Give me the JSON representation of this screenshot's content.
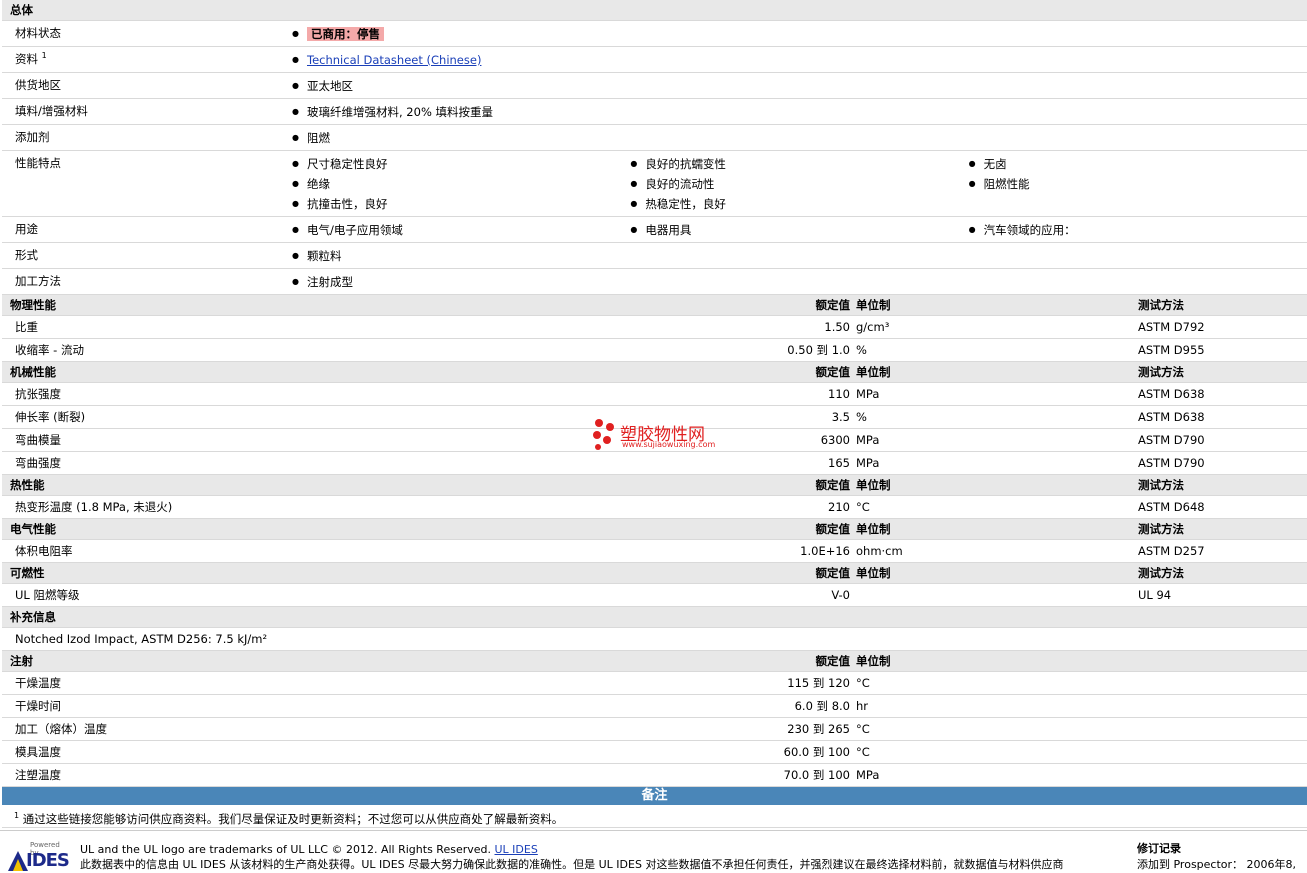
{
  "general": {
    "title": "总体",
    "rows": [
      {
        "label": "材料状态",
        "cols": [
          [
            "已商用：停售"
          ],
          [],
          []
        ],
        "highlight": true
      },
      {
        "label": "资料",
        "sup": "1",
        "cols": [
          [
            "Technical Datasheet (Chinese)"
          ],
          [],
          []
        ],
        "link": true
      },
      {
        "label": "供货地区",
        "cols": [
          [
            "亚太地区"
          ],
          [],
          []
        ]
      },
      {
        "label": "填料/增强材料",
        "cols": [
          [
            "玻璃纤维增强材料, 20% 填料按重量"
          ],
          [],
          []
        ]
      },
      {
        "label": "添加剂",
        "cols": [
          [
            "阻燃"
          ],
          [],
          []
        ]
      },
      {
        "label": "性能特点",
        "cols": [
          [
            "尺寸稳定性良好",
            "绝缘",
            "抗撞击性，良好"
          ],
          [
            "良好的抗蠕变性",
            "良好的流动性",
            "热稳定性，良好"
          ],
          [
            "无卤",
            "阻燃性能"
          ]
        ]
      },
      {
        "label": "用途",
        "cols": [
          [
            "电气/电子应用领域"
          ],
          [
            "电器用具"
          ],
          [
            "汽车领域的应用："
          ]
        ]
      },
      {
        "label": "形式",
        "cols": [
          [
            "颗粒料"
          ],
          [],
          []
        ]
      },
      {
        "label": "加工方法",
        "cols": [
          [
            "注射成型"
          ],
          [],
          []
        ]
      }
    ]
  },
  "headers": {
    "nominal": "额定值",
    "unit": "单位制",
    "test": "测试方法"
  },
  "sections": [
    {
      "title": "物理性能",
      "test_header": true,
      "rows": [
        {
          "label": "比重",
          "value": "1.50",
          "unit": "g/cm³",
          "test": "ASTM D792"
        },
        {
          "label": "收缩率  - 流动",
          "value": "0.50 到  1.0",
          "unit": "%",
          "test": "ASTM D955"
        }
      ]
    },
    {
      "title": "机械性能",
      "test_header": true,
      "rows": [
        {
          "label": "抗张强度",
          "value": "110",
          "unit": "MPa",
          "test": "ASTM D638"
        },
        {
          "label": "伸长率 (断裂)",
          "value": "3.5",
          "unit": "%",
          "test": "ASTM D638"
        },
        {
          "label": "弯曲模量",
          "value": "6300",
          "unit": "MPa",
          "test": "ASTM D790"
        },
        {
          "label": "弯曲强度",
          "value": "165",
          "unit": "MPa",
          "test": "ASTM D790"
        }
      ]
    },
    {
      "title": "热性能",
      "test_header": true,
      "rows": [
        {
          "label": "热变形温度 (1.8 MPa, 未退火)",
          "value": "210",
          "unit": "°C",
          "test": "ASTM D648"
        }
      ]
    },
    {
      "title": "电气性能",
      "test_header": true,
      "rows": [
        {
          "label": "体积电阻率",
          "value": "1.0E+16",
          "unit": "ohm·cm",
          "test": "ASTM D257"
        }
      ]
    },
    {
      "title": "可燃性",
      "test_header": true,
      "rows": [
        {
          "label": "UL 阻燃等级",
          "value": "V-0",
          "unit": "",
          "test": "UL 94"
        }
      ]
    }
  ],
  "supplement": {
    "title": "补充信息",
    "text": "Notched Izod Impact, ASTM D256: 7.5 kJ/m²"
  },
  "injection": {
    "title": "注射",
    "rows": [
      {
        "label": "干燥温度",
        "value": "115 到  120",
        "unit": "°C"
      },
      {
        "label": "干燥时间",
        "value": "6.0 到  8.0",
        "unit": "hr"
      },
      {
        "label": "加工（熔体）温度",
        "value": "230 到  265",
        "unit": "°C"
      },
      {
        "label": "模具温度",
        "value": "60.0 到  100",
        "unit": "°C"
      },
      {
        "label": "注塑温度",
        "value": "70.0 到  100",
        "unit": "MPa"
      }
    ]
  },
  "notes": {
    "title": "备注",
    "sup": "1",
    "text": "通过这些链接您能够访问供应商资料。我们尽量保证及时更新资料；不过您可以从供应商处了解最新资料。"
  },
  "footer": {
    "powered": "Powered by",
    "ides": "IDES",
    "line1": "UL and the UL logo are trademarks of UL LLC © 2012. All Rights Reserved.",
    "line1_link": "UL IDES",
    "line2": "此数据表中的信息由  UL IDES 从该材料的生产商处获得。UL IDES 尽最大努力确保此数据的准确性。但是  UL IDES 对这些数据值不承担任何责任，并强烈建议在最终选择材料前，就数据值与材料供应商",
    "rev_title": "修订记录",
    "rev_line": "添加到  Prospector：  2006年8,"
  },
  "watermark": {
    "cn": "塑胶物性网",
    "en": "www.sujiaowuxing.com"
  }
}
